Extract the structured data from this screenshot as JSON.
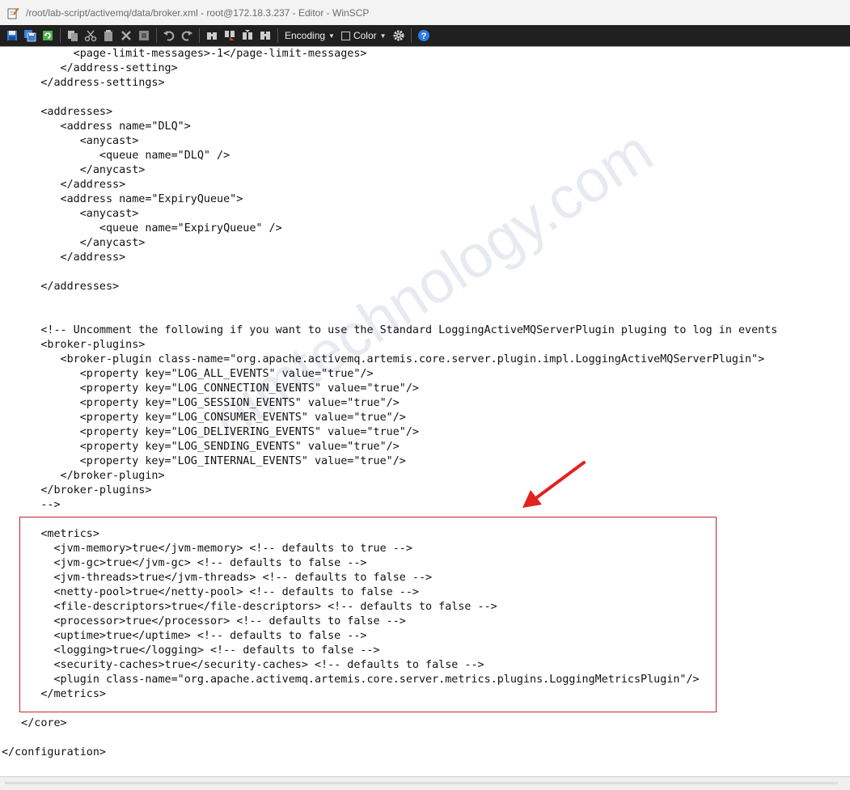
{
  "window": {
    "title": "/root/lab-script/activemq/data/broker.xml - root@172.18.3.237 - Editor - WinSCP",
    "app_icon": "notepad-edit-icon"
  },
  "toolbar": {
    "icons": [
      "save-icon",
      "save-all-icon",
      "reload-icon",
      "copy-icon",
      "cut-icon",
      "paste-icon",
      "delete-icon",
      "select-all-icon",
      "undo-icon",
      "redo-icon",
      "find-icon",
      "replace-icon",
      "find-next-icon",
      "go-to-line-icon"
    ],
    "encoding_label": "Encoding",
    "color_label": "Color",
    "settings_icon": "gear-icon",
    "help_icon": "help-icon"
  },
  "editor": {
    "lines": [
      "           <page-limit-messages>-1</page-limit-messages>",
      "         </address-setting>",
      "      </address-settings>",
      "",
      "      <addresses>",
      "         <address name=\"DLQ\">",
      "            <anycast>",
      "               <queue name=\"DLQ\" />",
      "            </anycast>",
      "         </address>",
      "         <address name=\"ExpiryQueue\">",
      "            <anycast>",
      "               <queue name=\"ExpiryQueue\" />",
      "            </anycast>",
      "         </address>",
      "",
      "      </addresses>",
      "",
      "",
      "      <!-- Uncomment the following if you want to use the Standard LoggingActiveMQServerPlugin pluging to log in events",
      "      <broker-plugins>",
      "         <broker-plugin class-name=\"org.apache.activemq.artemis.core.server.plugin.impl.LoggingActiveMQServerPlugin\">",
      "            <property key=\"LOG_ALL_EVENTS\" value=\"true\"/>",
      "            <property key=\"LOG_CONNECTION_EVENTS\" value=\"true\"/>",
      "            <property key=\"LOG_SESSION_EVENTS\" value=\"true\"/>",
      "            <property key=\"LOG_CONSUMER_EVENTS\" value=\"true\"/>",
      "            <property key=\"LOG_DELIVERING_EVENTS\" value=\"true\"/>",
      "            <property key=\"LOG_SENDING_EVENTS\" value=\"true\"/>",
      "            <property key=\"LOG_INTERNAL_EVENTS\" value=\"true\"/>",
      "         </broker-plugin>",
      "      </broker-plugins>",
      "      -->",
      "",
      "      <metrics>",
      "        <jvm-memory>true</jvm-memory> <!-- defaults to true -->",
      "        <jvm-gc>true</jvm-gc> <!-- defaults to false -->",
      "        <jvm-threads>true</jvm-threads> <!-- defaults to false -->",
      "        <netty-pool>true</netty-pool> <!-- defaults to false -->",
      "        <file-descriptors>true</file-descriptors> <!-- defaults to false -->",
      "        <processor>true</processor> <!-- defaults to false -->",
      "        <uptime>true</uptime> <!-- defaults to false -->",
      "        <logging>true</logging> <!-- defaults to false -->",
      "        <security-caches>true</security-caches> <!-- defaults to false -->",
      "        <plugin class-name=\"org.apache.activemq.artemis.core.server.metrics.plugins.LoggingMetricsPlugin\"/>",
      "      </metrics>",
      "",
      "   </core>",
      "",
      "</configuration>"
    ],
    "watermark": "nimtechnology.com"
  },
  "colors": {
    "toolbar_bg": "#202020",
    "highlight_border": "#c0262b",
    "arrow": "#e0231f"
  }
}
